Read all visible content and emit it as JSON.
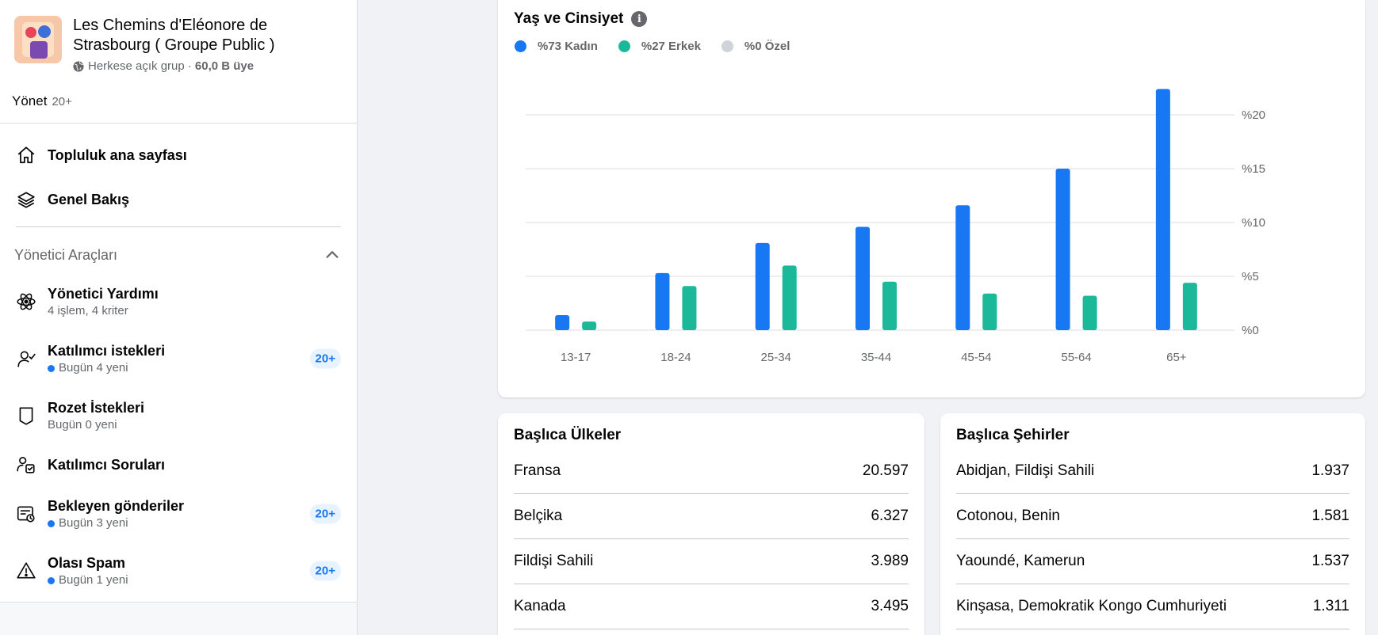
{
  "group": {
    "name_line1": "Les Chemins d'Eléonore de",
    "name_line2": "Strasbourg ( Groupe Public )",
    "privacy": "Herkese açık grup ·",
    "members": "60,0 B üye"
  },
  "manage": {
    "label": "Yönet",
    "count": "20+"
  },
  "nav": {
    "home_label": "Topluluk ana sayfası",
    "overview_label": "Genel Bakış"
  },
  "admin_tools": {
    "title": "Yönetici Araçları",
    "items": [
      {
        "title": "Yönetici Yardımı",
        "sub": "4 işlem, 4 kriter",
        "dot": false,
        "badge": ""
      },
      {
        "title": "Katılımcı istekleri",
        "sub": "Bugün 4 yeni",
        "dot": true,
        "badge": "20+"
      },
      {
        "title": "Rozet İstekleri",
        "sub": "Bugün 0 yeni",
        "dot": false,
        "badge": ""
      },
      {
        "title": "Katılımcı Soruları",
        "sub": "",
        "dot": false,
        "badge": ""
      },
      {
        "title": "Bekleyen gönderiler",
        "sub": "Bugün 3 yeni",
        "dot": true,
        "badge": "20+"
      },
      {
        "title": "Olası Spam",
        "sub": "Bugün 1 yeni",
        "dot": true,
        "badge": "20+"
      }
    ]
  },
  "age_gender": {
    "title": "Yaş ve Cinsiyet",
    "legend": [
      {
        "label": "%73 Kadın",
        "color": "#1877f2"
      },
      {
        "label": "%27 Erkek",
        "color": "#1bb99a"
      },
      {
        "label": "%0 Özel",
        "color": "#d0d3d8"
      }
    ]
  },
  "chart_data": {
    "type": "bar",
    "title": "Yaş ve Cinsiyet",
    "categories": [
      "13-17",
      "18-24",
      "25-34",
      "35-44",
      "45-54",
      "55-64",
      "65+"
    ],
    "series": [
      {
        "name": "%73 Kadın",
        "color": "#1877f2",
        "values": [
          1.4,
          5.3,
          8.1,
          9.6,
          11.6,
          15.0,
          22.4
        ]
      },
      {
        "name": "%27 Erkek",
        "color": "#1bb99a",
        "values": [
          0.8,
          4.1,
          6.0,
          4.5,
          3.4,
          3.2,
          4.4
        ]
      }
    ],
    "yticks": [
      "%0",
      "%5",
      "%10",
      "%15",
      "%20"
    ],
    "ylim": [
      0,
      20
    ],
    "grid": true,
    "legend": "top-left"
  },
  "countries": {
    "title": "Başlıca Ülkeler",
    "rows": [
      {
        "name": "Fransa",
        "value": "20.597"
      },
      {
        "name": "Belçika",
        "value": "6.327"
      },
      {
        "name": "Fildişi Sahili",
        "value": "3.989"
      },
      {
        "name": "Kanada",
        "value": "3.495"
      }
    ]
  },
  "cities": {
    "title": "Başlıca Şehirler",
    "rows": [
      {
        "name": "Abidjan, Fildişi Sahili",
        "value": "1.937"
      },
      {
        "name": "Cotonou, Benin",
        "value": "1.581"
      },
      {
        "name": "Yaoundé, Kamerun",
        "value": "1.537"
      },
      {
        "name": "Kinşasa, Demokratik Kongo Cumhuriyeti",
        "value": "1.311"
      }
    ]
  }
}
